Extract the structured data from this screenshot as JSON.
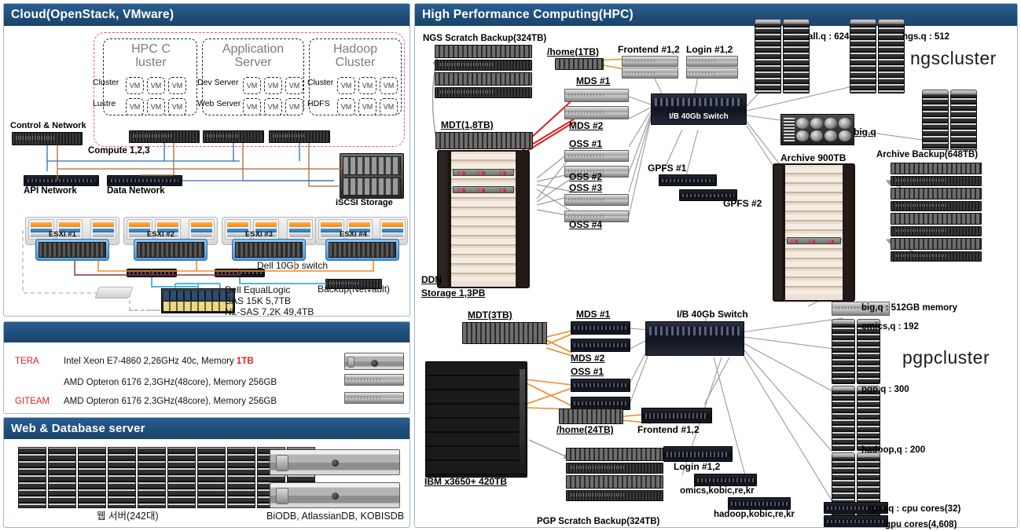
{
  "cloud": {
    "title": "Cloud(OpenStack, VMware)",
    "clusters": [
      {
        "name": "HPC C\nluster",
        "rows": [
          "Cluster",
          "Lustre"
        ]
      },
      {
        "name": "Application\nServer",
        "rows": [
          "Dev Server",
          "Web Server"
        ]
      },
      {
        "name": "Hadoop\nCluster",
        "rows": [
          "Cluster",
          "HDFS"
        ]
      }
    ],
    "vm_label": "VM",
    "labels": {
      "control_network": "Control & Network",
      "compute": "Compute 1,2,3",
      "api_network": "API Network",
      "data_network": "Data Network",
      "iscsi_storage": "iSCSI Storage",
      "esxi": [
        "ESXi #1",
        "ESXi #2",
        "ESXi #3",
        "ESXi #4"
      ],
      "dell_switch": "Dell 10Gb  switch",
      "dell_equallogic": "Dell EqualLogic",
      "sas": "SAS 15K  5,7TB",
      "nlsas": "NL-SAS 7,2K  49,4TB",
      "backup": "Backup(Netvault)"
    }
  },
  "specs": {
    "rows": [
      {
        "tag": "TERA",
        "text": "Intel Xeon E7-4860  2,26GHz  40c,  Memory ",
        "highlight": "1TB"
      },
      {
        "tag": "",
        "text": "AMD Opteron  6176  2,3GHz(48core),  Memory 256GB",
        "highlight": ""
      },
      {
        "tag": "GITEAM",
        "text": "AMD Opteron  6176  2,3GHz(48core),  Memory 256GB",
        "highlight": ""
      }
    ]
  },
  "webdb": {
    "title": "Web & Database server",
    "web_caption": "웹 서버(242대)",
    "db_caption": "BiODB,  AtlassianDB, KOBISDB"
  },
  "hpc": {
    "title": "High Performance Computing(HPC)",
    "ngs": {
      "scratch_backup": "NGS Scratch Backup(324TB)",
      "mdt": "MDT(1,8TB)",
      "home": "/home(1TB)",
      "mds1": "MDS #1",
      "mds2": "MDS #2",
      "oss": [
        "OSS #1",
        "OSS #2",
        "OSS #3",
        "OSS #4"
      ],
      "frontend": "Frontend #1,2",
      "login": "Login #1,2",
      "switch": "I/B 40Gb Switch",
      "ddn": "DDN",
      "ddn_storage": "Storage 1,3PB",
      "gpfs1": "GPFS #1",
      "gpfs2": "GPFS #2",
      "archive": "Archive 900TB",
      "archive_backup": "Archive Backup(648TB)",
      "queues": [
        "all.q : 624",
        "ngs.q : 512",
        "big.q"
      ],
      "cluster_name": "ngscluster"
    },
    "pgp": {
      "mdt": "MDT(3TB)",
      "mds1": "MDS #1",
      "mds2": "MDS #2",
      "oss": [
        "OSS #1",
        "OSS #2"
      ],
      "home": "/home(24TB)",
      "frontend": "Frontend #1,2",
      "login": "Login #1,2",
      "switch": "I/B 40Gb Switch",
      "ibm": "IBM x3650+ 420TB",
      "scratch_backup": "PGP Scratch Backup(324TB)",
      "omics_host": "omics,kobic,re,kr",
      "hadoop_host": "hadoop,kobic,re,kr",
      "cluster_name": "pgpcluster",
      "queues": [
        "big,q : 512GB memory",
        "omics,q : 192",
        "pgp,q : 300",
        "hadoop,q : 200",
        "gpu,q : cpu cores(32)",
        "gpu cores(4,608)"
      ]
    }
  },
  "colors": {
    "header_blue": "#1f4e79",
    "accent_red": "#e02020",
    "dashed_red": "#e05a6e",
    "link_gray": "#8e8e8e",
    "link_orange": "#f08a22"
  }
}
